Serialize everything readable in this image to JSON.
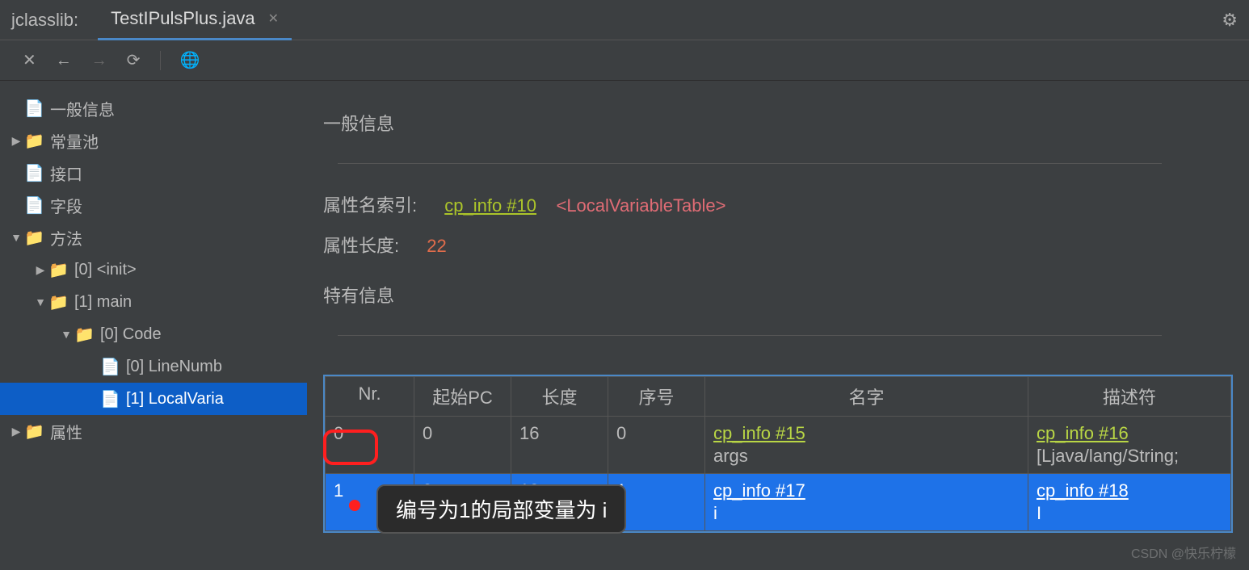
{
  "titlebar": {
    "app": "jclasslib:",
    "tab": "TestIPulsPlus.java"
  },
  "sidebar": {
    "items": [
      {
        "label": "一般信息",
        "icon": "file",
        "indent": 0,
        "arrow": ""
      },
      {
        "label": "常量池",
        "icon": "folder",
        "indent": 0,
        "arrow": "right"
      },
      {
        "label": "接口",
        "icon": "file",
        "indent": 0,
        "arrow": ""
      },
      {
        "label": "字段",
        "icon": "file",
        "indent": 0,
        "arrow": ""
      },
      {
        "label": "方法",
        "icon": "folder",
        "indent": 0,
        "arrow": "down"
      },
      {
        "label": "[0] <init>",
        "icon": "folder",
        "indent": 1,
        "arrow": "right"
      },
      {
        "label": "[1] main",
        "icon": "folder",
        "indent": 1,
        "arrow": "down"
      },
      {
        "label": "[0] Code",
        "icon": "folder",
        "indent": 2,
        "arrow": "down"
      },
      {
        "label": "[0] LineNumb",
        "icon": "file",
        "indent": 3,
        "arrow": ""
      },
      {
        "label": "[1] LocalVaria",
        "icon": "file",
        "indent": 3,
        "arrow": "",
        "selected": true
      },
      {
        "label": "属性",
        "icon": "folder",
        "indent": 0,
        "arrow": "right"
      }
    ]
  },
  "content": {
    "section_general": "一般信息",
    "attr_name_label": "属性名索引:",
    "attr_name_link": "cp_info #10",
    "attr_name_value": "<LocalVariableTable>",
    "attr_len_label": "属性长度:",
    "attr_len_value": "22",
    "section_specific": "特有信息",
    "table": {
      "headers": [
        "Nr.",
        "起始PC",
        "长度",
        "序号",
        "名字",
        "描述符"
      ],
      "rows": [
        {
          "nr": "0",
          "pc": "0",
          "len": "16",
          "idx": "0",
          "name_link": "cp_info #15",
          "name_sub": "args",
          "desc_link": "cp_info #16",
          "desc_sub": "[Ljava/lang/String;"
        },
        {
          "nr": "1",
          "pc": "3",
          "len": "13",
          "idx": "1",
          "name_link": "cp_info #17",
          "name_sub": "i",
          "desc_link": "cp_info #18",
          "desc_sub": "I",
          "selected": true
        }
      ]
    }
  },
  "callout": "编号为1的局部变量为 i",
  "watermark": "CSDN @快乐柠檬"
}
